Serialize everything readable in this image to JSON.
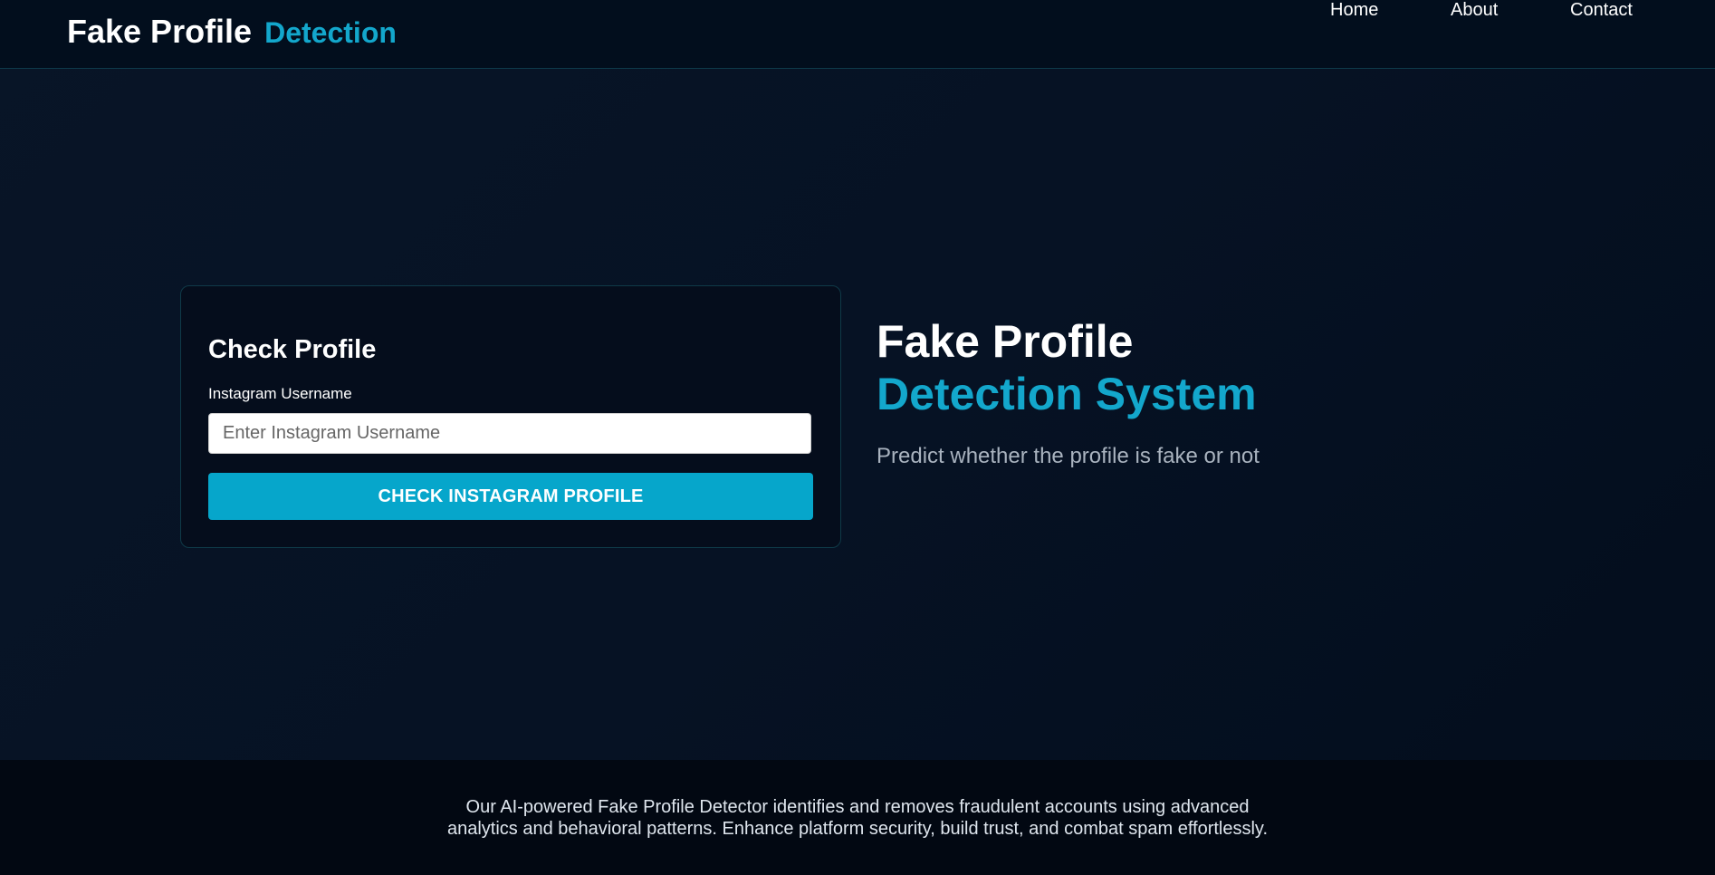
{
  "navbar": {
    "brand_main": "Fake Profile",
    "brand_accent": "Detection",
    "links": [
      "Home",
      "About",
      "Contact"
    ]
  },
  "form": {
    "title": "Check Profile",
    "field_label": "Instagram Username",
    "input_placeholder": "Enter Instagram Username",
    "input_value": "",
    "submit_label": "CHECK INSTAGRAM PROFILE"
  },
  "hero": {
    "title_line1": "Fake Profile",
    "title_line2": "Detection System",
    "subtitle": "Predict whether the profile is fake or not"
  },
  "footer": {
    "line1": "Our AI-powered Fake Profile Detector identifies and removes fraudulent accounts using advanced",
    "line2": "analytics and behavioral patterns. Enhance platform security, build trust, and combat spam effortlessly."
  },
  "colors": {
    "accent": "#13a7cc",
    "button": "#06a6cb",
    "background": "#061224"
  }
}
